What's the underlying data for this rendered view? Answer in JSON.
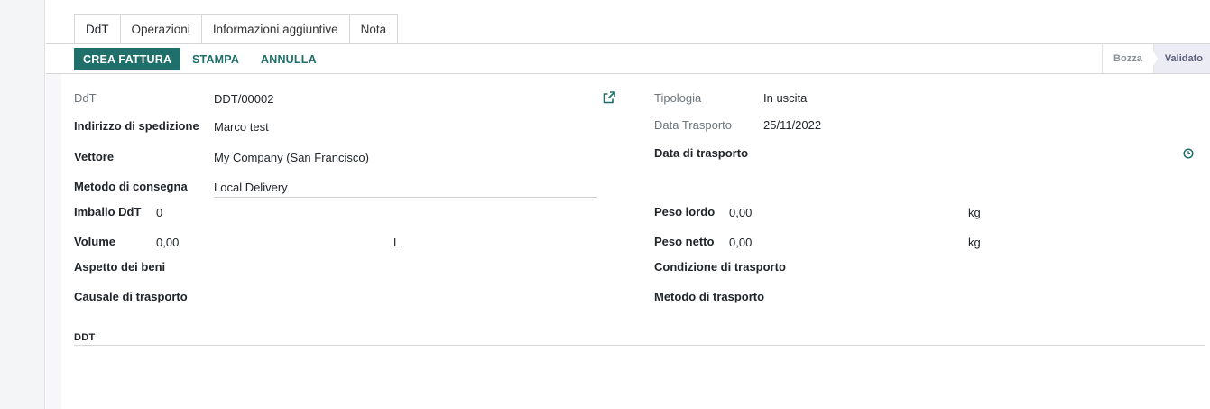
{
  "tabs": [
    {
      "label": "DdT",
      "active": true
    },
    {
      "label": "Operazioni",
      "active": false
    },
    {
      "label": "Informazioni aggiuntive",
      "active": false
    },
    {
      "label": "Nota",
      "active": false
    }
  ],
  "toolbar": {
    "crea_fattura": "CREA FATTURA",
    "stampa": "STAMPA",
    "annulla": "ANNULLA"
  },
  "statusbar": {
    "bozza": "Bozza",
    "validato": "Validato"
  },
  "form": {
    "ddt_label": "DdT",
    "ddt_value": "DDT/00002",
    "indirizzo_label": "Indirizzo di spedizione",
    "indirizzo_value": "Marco test",
    "vettore_label": "Vettore",
    "vettore_value": "My Company (San Francisco)",
    "metodo_consegna_label": "Metodo di consegna",
    "metodo_consegna_value": "Local Delivery",
    "imballo_label": "Imballo DdT",
    "imballo_value": "0",
    "volume_label": "Volume",
    "volume_value": "0,00",
    "volume_unit": "L",
    "aspetto_label": "Aspetto dei beni",
    "causale_label": "Causale di trasporto",
    "tipologia_label": "Tipologia",
    "tipologia_value": "In uscita",
    "data_trasporto_label": "Data Trasporto",
    "data_trasporto_value": "25/11/2022",
    "data_di_trasporto_label": "Data di trasporto",
    "peso_lordo_label": "Peso lordo",
    "peso_lordo_value": "0,00",
    "peso_lordo_unit": "kg",
    "peso_netto_label": "Peso netto",
    "peso_netto_value": "0,00",
    "peso_netto_unit": "kg",
    "condizione_label": "Condizione di trasporto",
    "metodo_trasporto_label": "Metodo di trasporto",
    "section_ddt": "DDT"
  },
  "icons": {
    "external_link": "external-link-icon",
    "clock": "clock-icon"
  },
  "colors": {
    "primary": "#1f6f6a"
  }
}
